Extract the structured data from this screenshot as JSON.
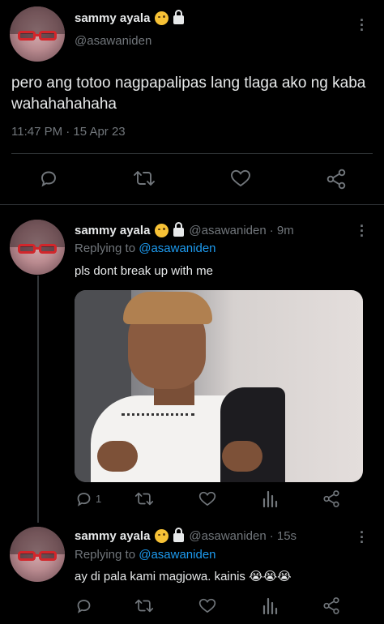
{
  "main_tweet": {
    "display_name": "sammy ayala",
    "handle": "@asawaniden",
    "text": "pero ang totoo nagpapalipas lang tlaga ako ng kaba wahahahahaha",
    "timestamp": "11:47 PM · 15 Apr 23",
    "more_label": "⋮"
  },
  "replies": [
    {
      "display_name": "sammy ayala",
      "handle": "@asawaniden",
      "time": "· 9m",
      "replying_prefix": "Replying to",
      "replying_to": "@asawaniden",
      "text": "pls dont break up with me",
      "reply_count": "1",
      "more_label": "⋮"
    },
    {
      "display_name": "sammy ayala",
      "handle": "@asawaniden",
      "time": "· 15s",
      "replying_prefix": "Replying to",
      "replying_to": "@asawaniden",
      "text": "ay di pala kami magjowa. kainis 😭😭😭",
      "reply_count": "",
      "more_label": "⋮"
    }
  ],
  "colors": {
    "background": "#000000",
    "text": "#e7e9ea",
    "secondary": "#71767b",
    "accent": "#1d9bf0",
    "divider": "#2f3336"
  },
  "icons": [
    "reply-icon",
    "retweet-icon",
    "like-icon",
    "analytics-icon",
    "share-icon",
    "more-icon",
    "lock-icon",
    "smiling-emoji-icon"
  ]
}
